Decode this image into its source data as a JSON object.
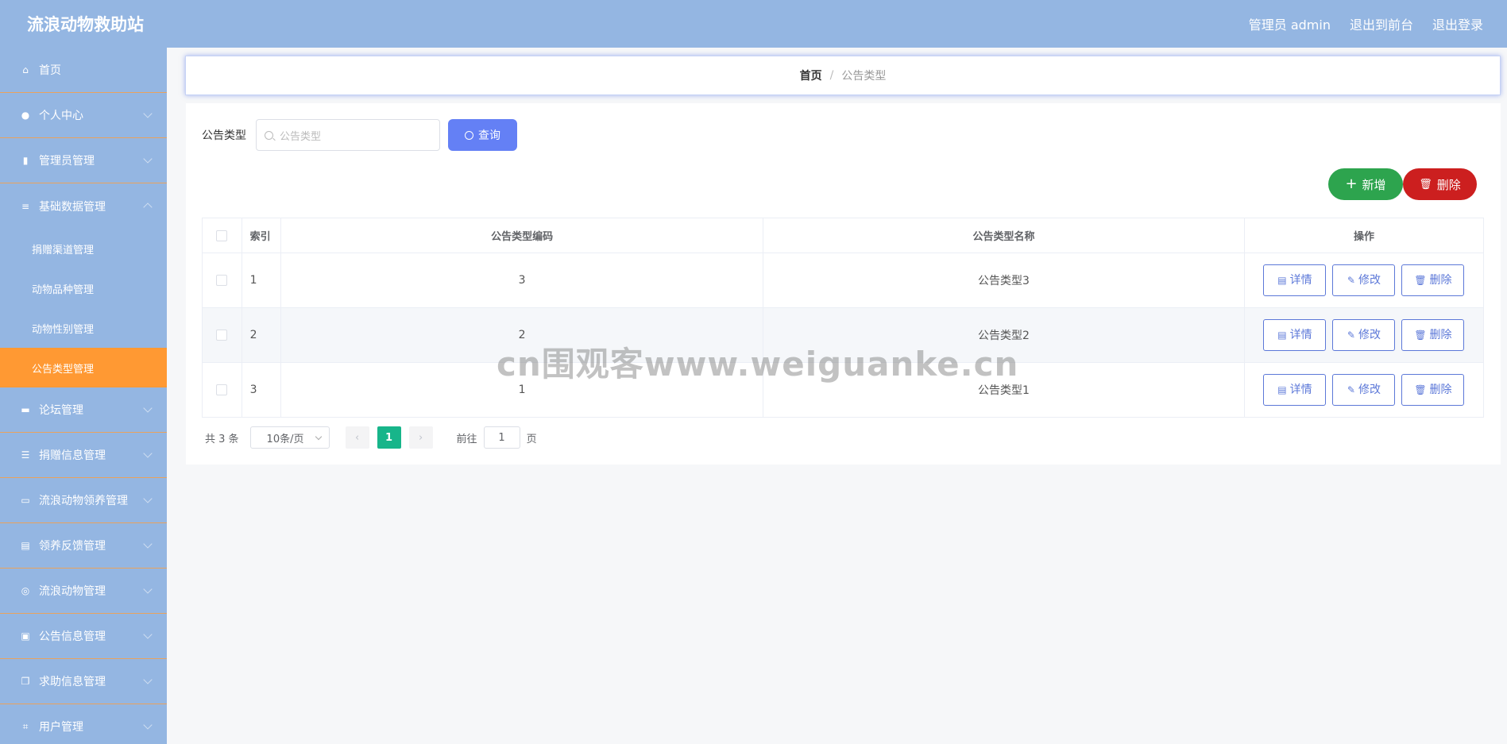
{
  "header": {
    "title": "流浪动物救助站",
    "links": [
      "管理员 admin",
      "退出到前台",
      "退出登录"
    ]
  },
  "sidebar": {
    "items": [
      {
        "label": "首页",
        "icon": "home-icon"
      },
      {
        "label": "个人中心",
        "icon": "user-icon"
      },
      {
        "label": "管理员管理",
        "icon": "bar-chart-icon"
      },
      {
        "label": "基础数据管理",
        "icon": "list-icon",
        "children": [
          "捐赠渠道管理",
          "动物品种管理",
          "动物性别管理",
          "公告类型管理"
        ],
        "active_child": "公告类型管理"
      },
      {
        "label": "论坛管理",
        "icon": "briefcase-icon"
      },
      {
        "label": "捐赠信息管理",
        "icon": "sliders-icon"
      },
      {
        "label": "流浪动物领养管理",
        "icon": "card-icon"
      },
      {
        "label": "领养反馈管理",
        "icon": "clipboard-icon"
      },
      {
        "label": "流浪动物管理",
        "icon": "globe-icon"
      },
      {
        "label": "公告信息管理",
        "icon": "clipboard-check-icon"
      },
      {
        "label": "求助信息管理",
        "icon": "copy-icon"
      },
      {
        "label": "用户管理",
        "icon": "crop-icon"
      }
    ]
  },
  "breadcrumb": {
    "home": "首页",
    "current": "公告类型"
  },
  "search": {
    "label": "公告类型",
    "placeholder": "公告类型",
    "button": "查询"
  },
  "actions": {
    "add": "新增",
    "delete": "删除"
  },
  "table": {
    "headers": [
      "索引",
      "公告类型编码",
      "公告类型名称",
      "操作"
    ],
    "rows": [
      {
        "index": "1",
        "code": "3",
        "name": "公告类型3"
      },
      {
        "index": "2",
        "code": "2",
        "name": "公告类型2"
      },
      {
        "index": "3",
        "code": "1",
        "name": "公告类型1"
      }
    ],
    "row_buttons": {
      "detail": "详情",
      "edit": "修改",
      "delete": "删除"
    }
  },
  "pagination": {
    "total": "共 3 条",
    "page_size": "10条/页",
    "current_page": "1",
    "goto_label": "前往",
    "goto_value": "1",
    "goto_suffix": "页"
  },
  "watermark": "cn围观客www.weiguanke.cn",
  "colors": {
    "header": "#94b6e2",
    "active_menu": "#ff9933",
    "primary": "#6480f5",
    "add": "#2da44e",
    "delete": "#cc1f1f",
    "page_active": "#17b58a"
  }
}
